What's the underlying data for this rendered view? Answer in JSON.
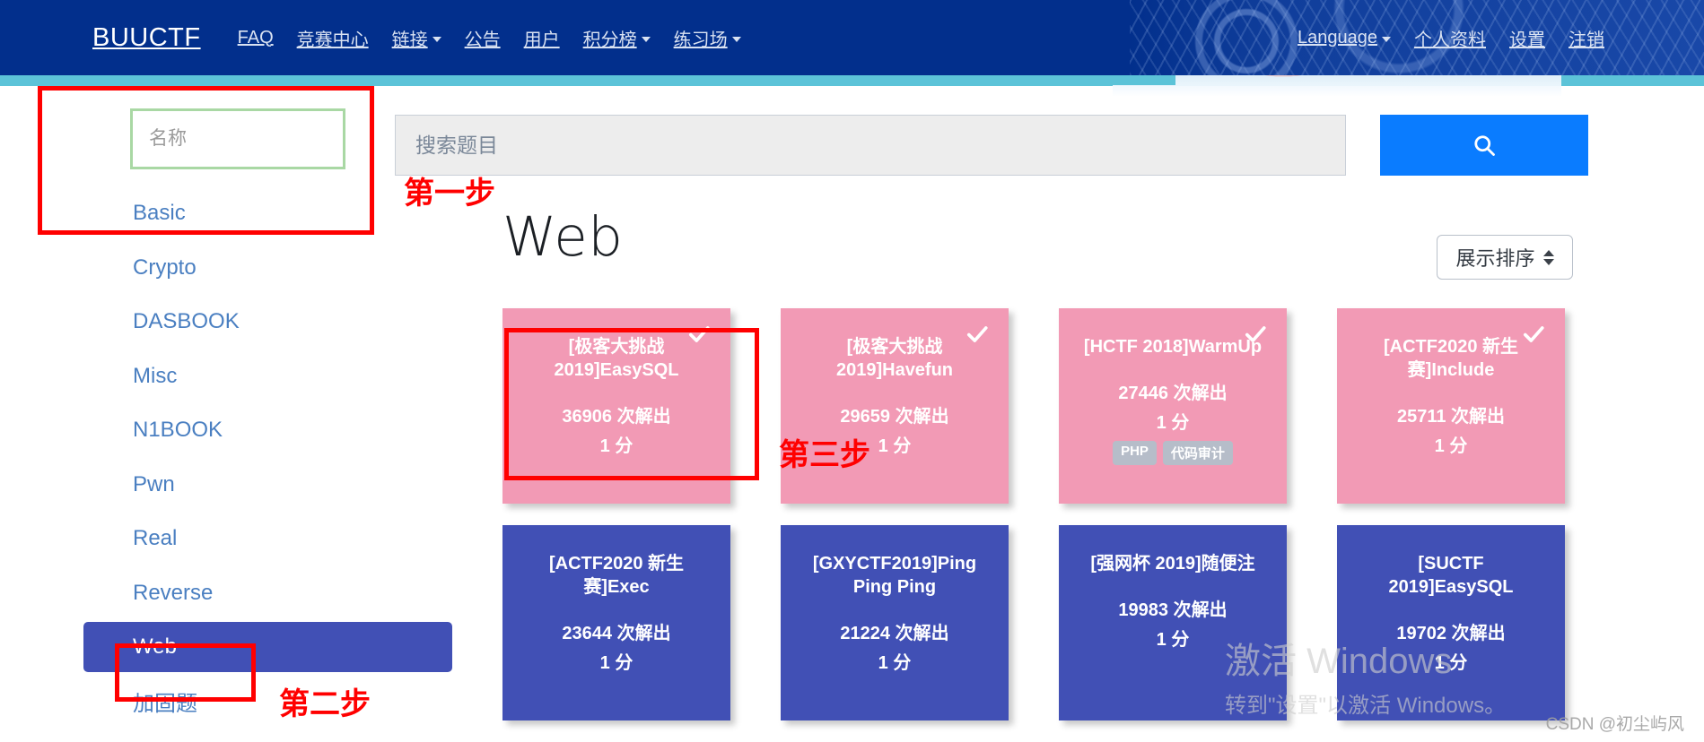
{
  "navbar": {
    "brand": "BUUCTF",
    "left_items": [
      {
        "label": "FAQ",
        "caret": false
      },
      {
        "label": "竞赛中心",
        "caret": false
      },
      {
        "label": "链接",
        "caret": true
      },
      {
        "label": "公告",
        "caret": false
      },
      {
        "label": "用户",
        "caret": false
      },
      {
        "label": "积分榜",
        "caret": true
      },
      {
        "label": "练习场",
        "caret": true
      }
    ],
    "right_items": [
      {
        "label": "Language",
        "caret": true
      },
      {
        "label": "个人资料",
        "caret": false
      },
      {
        "label": "设置",
        "caret": false
      },
      {
        "label": "注销",
        "caret": false
      }
    ]
  },
  "sidebar": {
    "filter_placeholder": "名称",
    "filter_value": "",
    "items": [
      {
        "label": "Basic",
        "active": false
      },
      {
        "label": "Crypto",
        "active": false
      },
      {
        "label": "DASBOOK",
        "active": false
      },
      {
        "label": "Misc",
        "active": false
      },
      {
        "label": "N1BOOK",
        "active": false
      },
      {
        "label": "Pwn",
        "active": false
      },
      {
        "label": "Real",
        "active": false
      },
      {
        "label": "Reverse",
        "active": false
      },
      {
        "label": "Web",
        "active": true
      },
      {
        "label": "加固题",
        "active": false
      }
    ]
  },
  "search": {
    "placeholder": "搜索题目",
    "value": "",
    "button_icon": "search-icon"
  },
  "main": {
    "title": "Web",
    "sort_label": "展示排序",
    "sort_icon": "up-down-arrow-icon"
  },
  "cards": [
    {
      "title": "[极客大挑战 2019]EasySQL",
      "solves": "36906 次解出",
      "points": "1 分",
      "solved": true,
      "tags": []
    },
    {
      "title": "[极客大挑战 2019]Havefun",
      "solves": "29659 次解出",
      "points": "1 分",
      "solved": true,
      "tags": []
    },
    {
      "title": "[HCTF 2018]WarmUp",
      "solves": "27446 次解出",
      "points": "1 分",
      "solved": true,
      "tags": [
        "PHP",
        "代码审计"
      ]
    },
    {
      "title": "[ACTF2020 新生赛]Include",
      "solves": "25711 次解出",
      "points": "1 分",
      "solved": true,
      "tags": []
    },
    {
      "title": "[ACTF2020 新生赛]Exec",
      "solves": "23644 次解出",
      "points": "1 分",
      "solved": false,
      "tags": []
    },
    {
      "title": "[GXYCTF2019]Ping Ping Ping",
      "solves": "21224 次解出",
      "points": "1 分",
      "solved": false,
      "tags": []
    },
    {
      "title": "[强网杯 2019]随便注",
      "solves": "19983 次解出",
      "points": "1 分",
      "solved": false,
      "tags": []
    },
    {
      "title": "[SUCTF 2019]EasySQL",
      "solves": "19702 次解出",
      "points": "1 分",
      "solved": false,
      "tags": []
    }
  ],
  "annotations": {
    "step1": "第一步",
    "step2": "第二步",
    "step3": "第三步"
  },
  "watermarks": {
    "windows_line1": "激活 Windows",
    "windows_line2": "转到\"设置\"以激活 Windows。",
    "csdn": "CSDN @初尘屿风"
  },
  "colors": {
    "navbar": "#022f8c",
    "teal_strip": "#5cc3d8",
    "accent_blue": "#0a7cff",
    "card_solved": "#f29ab5",
    "card_unsolved": "#4150b5",
    "annotation_red": "#ff0000",
    "sidebar_link": "#4a7fc1",
    "filter_border_green": "#a9d8a4"
  }
}
